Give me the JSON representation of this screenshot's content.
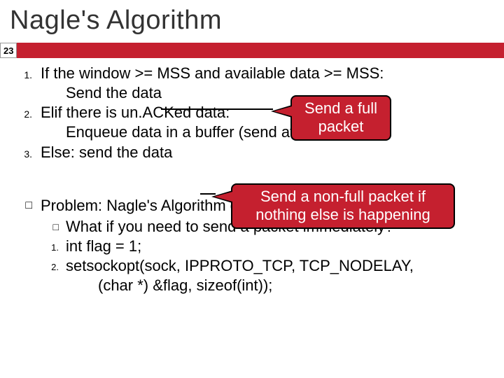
{
  "title": "Nagle's Algorithm",
  "slide_num": "23",
  "items": {
    "n1": "1.",
    "t1": "If the window >= MSS and available data >= MSS:",
    "s1": "Send the data",
    "n2": "2.",
    "t2": "Elif there is un.ACKed data:",
    "s2": "Enqueue data in a buffer (send after a timeout)",
    "n3": "3.",
    "t3": "Else: send the data",
    "problem": "Problem: Nagle's Algorithm delays transmissions",
    "what": "What if you need to send a packet immediately?",
    "c1n": "1.",
    "c1": "int flag = 1;",
    "c2n": "2.",
    "c2": "setsockopt(sock, IPPROTO_TCP, TCP_NODELAY,",
    "c2b": "(char *) &flag, sizeof(int));"
  },
  "callouts": {
    "co1a": "Send a full",
    "co1b": "packet",
    "co2a": "Send a non-full packet if",
    "co2b": "nothing else is happening"
  }
}
